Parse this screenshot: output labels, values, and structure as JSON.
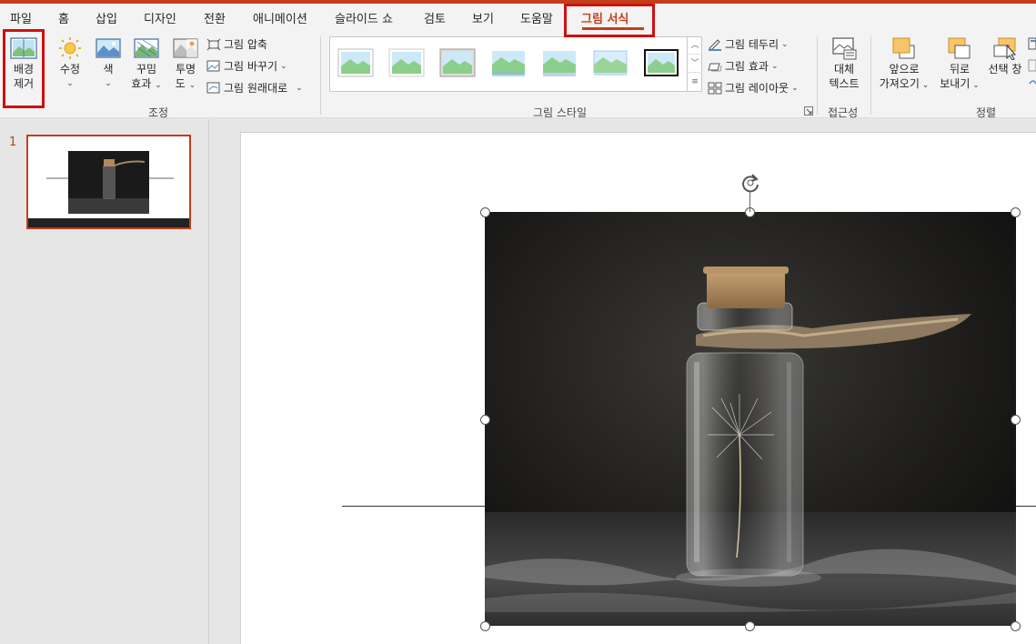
{
  "tabs": [
    "파일",
    "홈",
    "삽입",
    "디자인",
    "전환",
    "애니메이션",
    "슬라이드 쇼",
    "검토",
    "보기",
    "도움말",
    "그림 서식"
  ],
  "ribbon": {
    "remove_bg": {
      "line1": "배경",
      "line2": "제거"
    },
    "corrections": "수정",
    "color": "색",
    "artistic": {
      "line1": "꾸밈",
      "line2": "효과"
    },
    "transparency": {
      "line1": "투명",
      "line2": "도"
    },
    "compress": "그림 압축",
    "change": "그림 바꾸기",
    "reset": "그림 원래대로",
    "group_adjust": "조정",
    "group_styles": "그림 스타일",
    "border": "그림 테두리",
    "effects": "그림 효과",
    "layout": "그림 레이아웃",
    "alt_text": {
      "line1": "대체",
      "line2": "텍스트"
    },
    "group_access": "접근성",
    "bring_forward": {
      "line1": "앞으로",
      "line2": "가져오기"
    },
    "send_backward": {
      "line1": "뒤로",
      "line2": "보내기"
    },
    "selection_pane": "선택 창",
    "group_arrange": "정렬"
  },
  "sidebar": {
    "slide_number": "1"
  },
  "colors": {
    "accent": "#c43e1c",
    "highlight_box": "#d10f0f"
  }
}
